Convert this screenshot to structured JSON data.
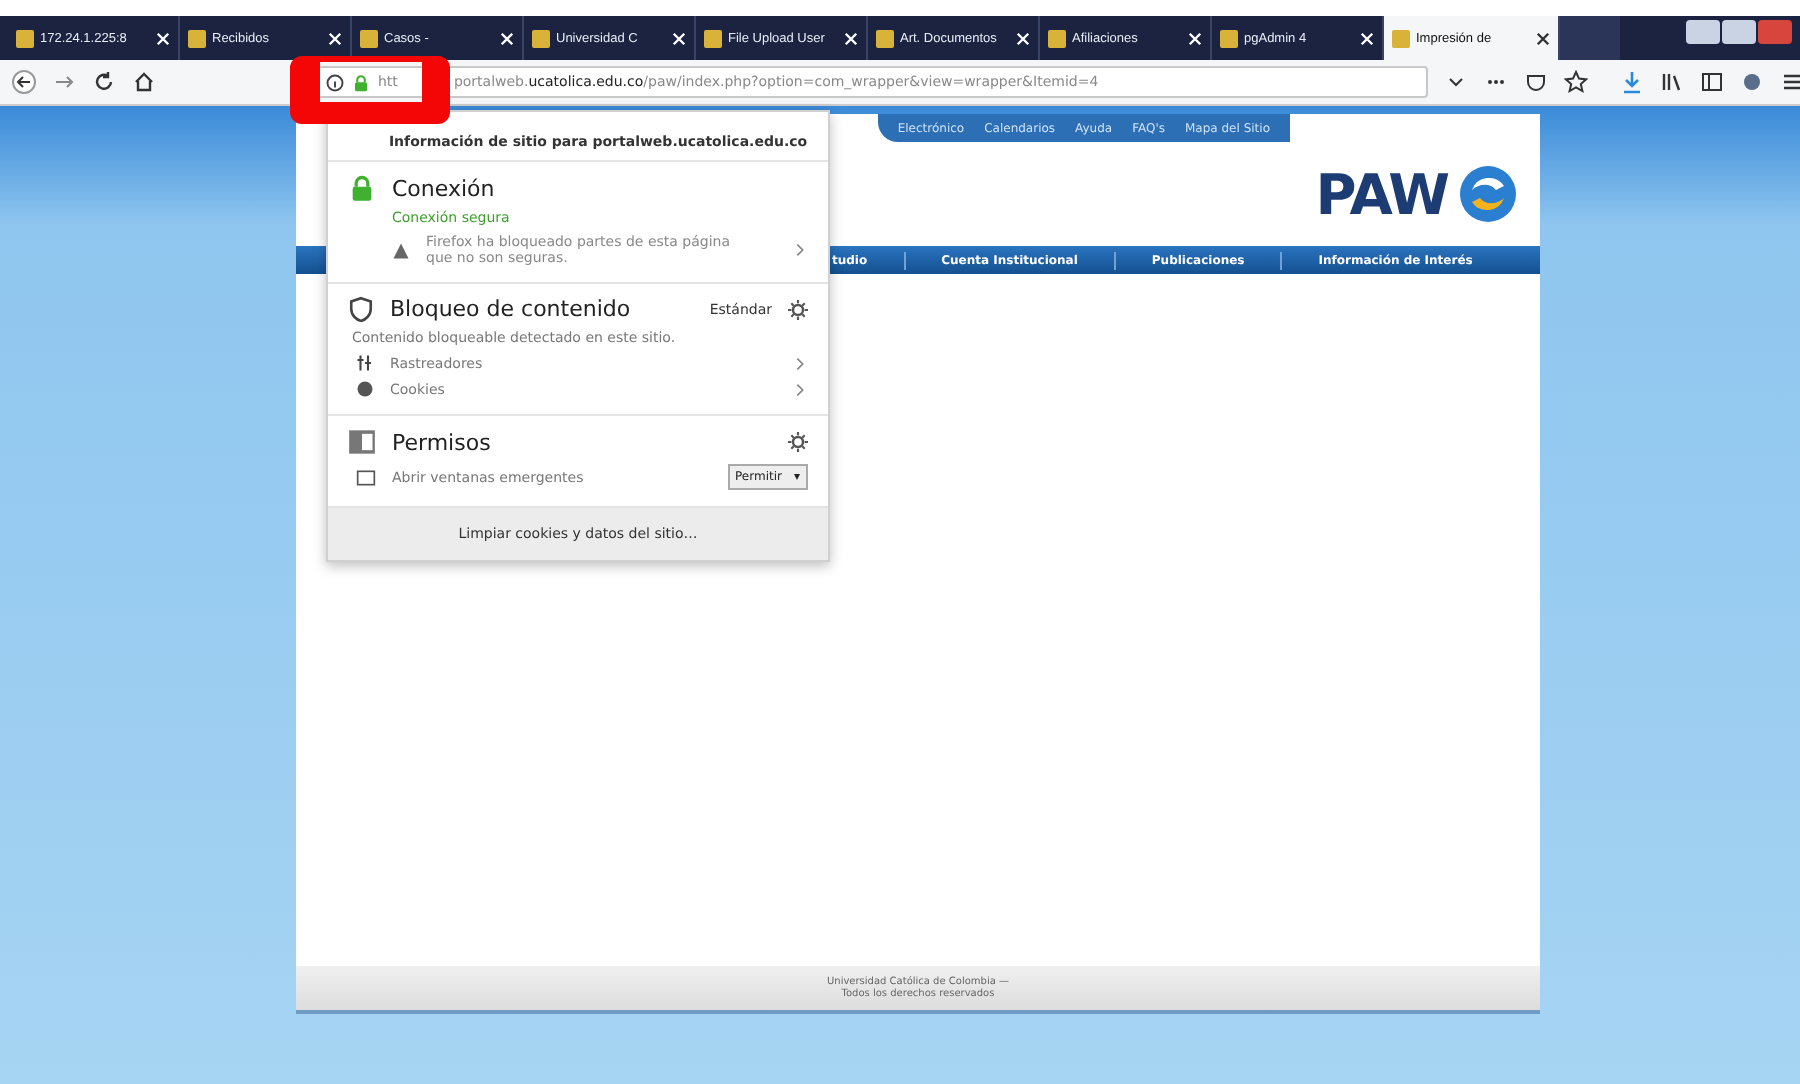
{
  "tabs": [
    {
      "label": "172.24.1.225:8",
      "selected": false
    },
    {
      "label": "Recibidos",
      "selected": false
    },
    {
      "label": "Casos -",
      "selected": false
    },
    {
      "label": "Universidad C",
      "selected": false
    },
    {
      "label": "File Upload User",
      "selected": false
    },
    {
      "label": "Art. Documentos",
      "selected": false
    },
    {
      "label": "Afiliaciones",
      "selected": false
    },
    {
      "label": "pgAdmin 4",
      "selected": false
    },
    {
      "label": "Impresión de",
      "selected": true
    }
  ],
  "address_bar": {
    "prefix": "htt",
    "url": "portalweb.**ucatolica.edu.co**/paw/index.php?option=com_wrapper&view=wrapper&Itemid=4"
  },
  "page": {
    "top_links": [
      "Electrónico",
      "Calendarios",
      "Ayuda",
      "FAQ's",
      "Mapa del Sitio"
    ],
    "logo": "PAW",
    "nav": [
      "tudio",
      "Cuenta Institucional",
      "Publicaciones",
      "Información de Interés"
    ],
    "footer": [
      "Universidad Católica de Colombia —",
      "Todos los derechos reservados"
    ]
  },
  "site_info_panel": {
    "title": "Información de sitio para portalweb.ucatolica.edu.co",
    "connection": {
      "title": "Conexión",
      "status": "Conexión segura",
      "warning": "Firefox ha bloqueado partes de esta página que no son seguras."
    },
    "content_blocking": {
      "title": "Bloqueo de contenido",
      "mode": "Estándar",
      "note": "Contenido bloqueable detectado en este sitio.",
      "items": [
        {
          "label": "Rastreadores",
          "kind": "trackers"
        },
        {
          "label": "Cookies",
          "kind": "cookies"
        }
      ]
    },
    "permissions": {
      "title": "Permisos",
      "items": [
        {
          "label": "Abrir ventanas emergentes",
          "value": "Permitir",
          "arrow": "▾"
        }
      ]
    },
    "clear_button": "Limpiar cookies y datos del sitio…"
  }
}
